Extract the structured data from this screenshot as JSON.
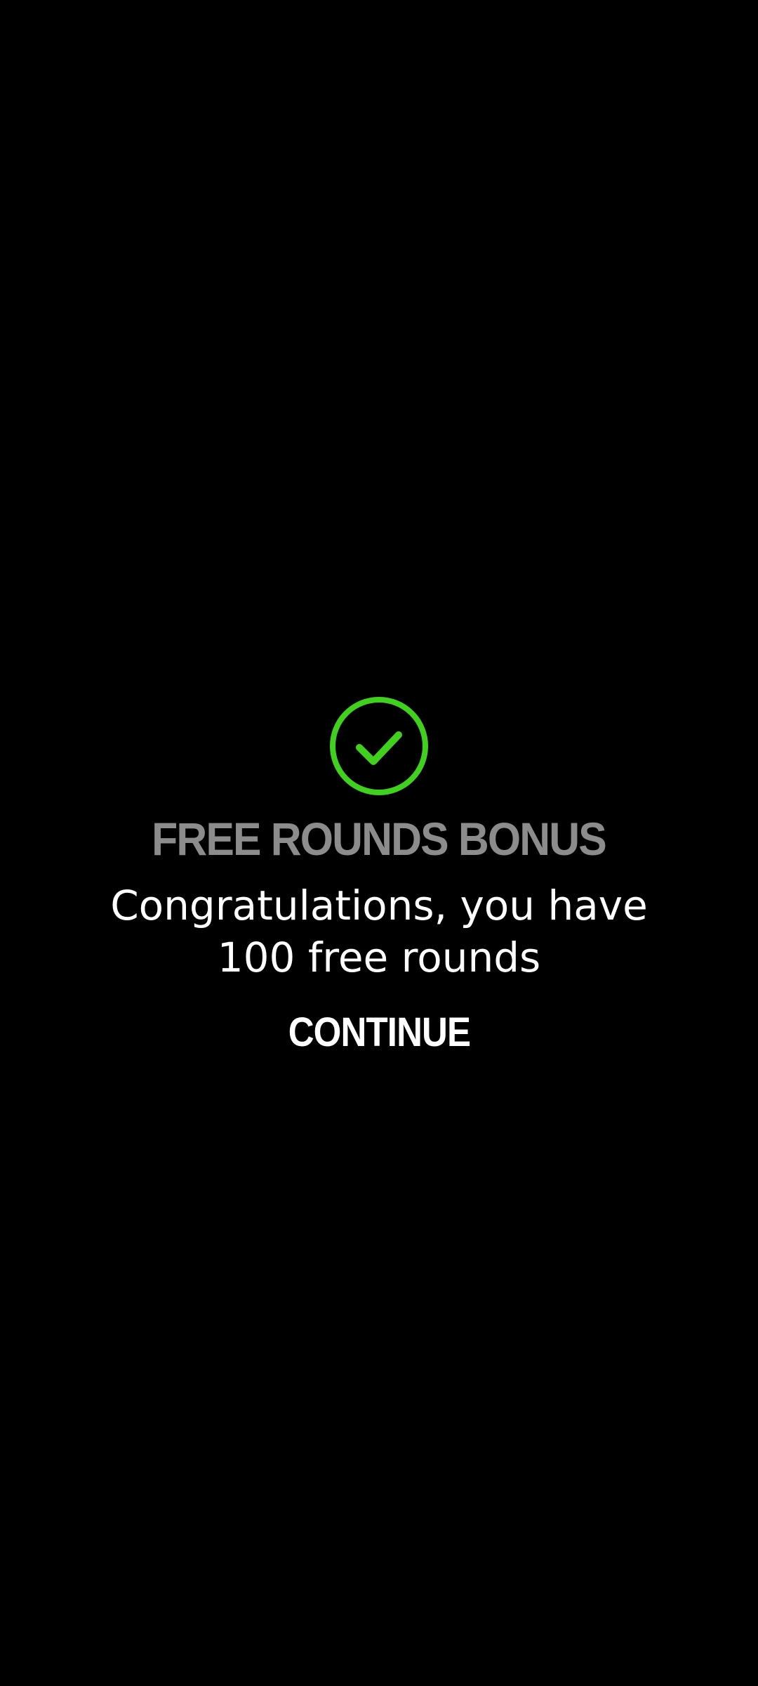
{
  "dialog": {
    "icon": "check-circle-icon",
    "icon_color": "#3fd11e",
    "title": "FREE ROUNDS BONUS",
    "title_color": "#8c8c8c",
    "message_line1": "Congratulations, you have",
    "message_line2": "100 free rounds",
    "continue_label": "CONTINUE"
  },
  "colors": {
    "background": "#000000",
    "text": "#ffffff"
  }
}
